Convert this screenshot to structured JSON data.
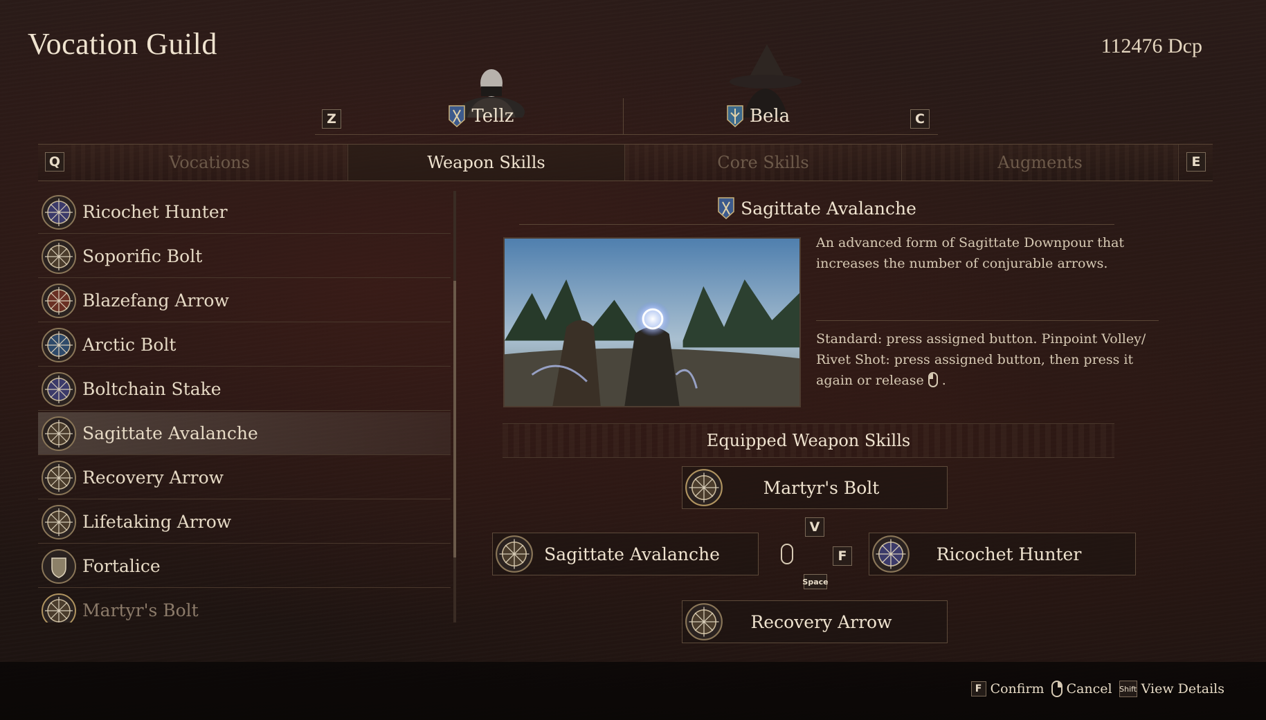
{
  "header": {
    "title": "Vocation Guild",
    "currency": "112476 Dcp"
  },
  "party": {
    "prev_key": "Z",
    "next_key": "C",
    "members": [
      {
        "name": "Tellz",
        "icon": "arisen-emblem-icon",
        "color": "#3c5a8c"
      },
      {
        "name": "Bela",
        "icon": "pawn-emblem-icon",
        "color": "#3c6a8c"
      }
    ]
  },
  "tabs": {
    "prev_key": "Q",
    "next_key": "E",
    "items": [
      {
        "label": "Vocations",
        "active": false
      },
      {
        "label": "Weapon Skills",
        "active": true
      },
      {
        "label": "Core Skills",
        "active": false
      },
      {
        "label": "Augments",
        "active": false
      }
    ]
  },
  "skill_list": {
    "items": [
      {
        "label": "Ricochet Hunter",
        "icon": "blue-crosshair-icon"
      },
      {
        "label": "Soporific Bolt",
        "icon": "gold-crosshair-icon"
      },
      {
        "label": "Blazefang Arrow",
        "icon": "red-crosshair-icon"
      },
      {
        "label": "Arctic Bolt",
        "icon": "blue-crosshair-icon"
      },
      {
        "label": "Boltchain Stake",
        "icon": "blue-crosshair-icon"
      },
      {
        "label": "Sagittate Avalanche",
        "icon": "gold-crosshair-icon",
        "selected": true
      },
      {
        "label": "Recovery Arrow",
        "icon": "gold-crosshair-icon"
      },
      {
        "label": "Lifetaking Arrow",
        "icon": "gold-crosshair-icon"
      },
      {
        "label": "Fortalice",
        "icon": "shield-icon"
      },
      {
        "label": "Martyr's Bolt",
        "icon": "gold-crosshair-icon",
        "faded": true
      }
    ]
  },
  "detail": {
    "title": "Sagittate Avalanche",
    "description": "An advanced form of Sagittate Downpour that increases the number of conjurable arrows.",
    "usage_before": "Standard: press assigned button. Pinpoint Volley/ Rivet Shot: press assigned button, then press it again or release",
    "usage_after": "."
  },
  "equipped": {
    "heading": "Equipped Weapon Skills",
    "top": "Martyr's Bolt",
    "left": "Sagittate Avalanche",
    "right": "Ricochet Hunter",
    "bottom": "Recovery Arrow",
    "keys": {
      "up": "V",
      "right": "F",
      "down": "Space"
    }
  },
  "footer": {
    "confirm_key": "F",
    "confirm": "Confirm",
    "cancel": "Cancel",
    "details_key": "Shift",
    "details": "View Details"
  }
}
